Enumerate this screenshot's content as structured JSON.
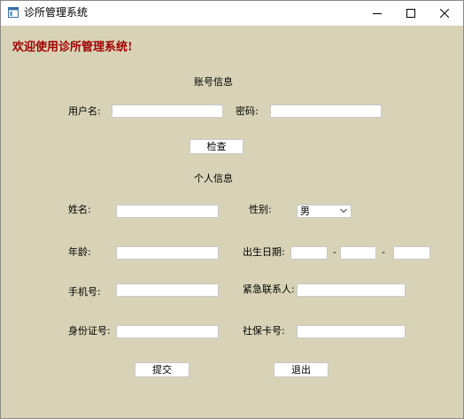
{
  "window": {
    "title": "诊所管理系统"
  },
  "welcome": "欢迎使用诊所管理系统!",
  "account": {
    "section_title": "账号信息",
    "username_label": "用户名:",
    "username_value": "",
    "password_label": "密码:",
    "password_value": "",
    "check_button": "检查"
  },
  "personal": {
    "section_title": "个人信息",
    "name_label": "姓名:",
    "name_value": "",
    "gender_label": "性别:",
    "gender_value": "男",
    "age_label": "年龄:",
    "age_value": "",
    "birth_label": "出生日期:",
    "birth_year": "",
    "birth_month": "",
    "birth_day": "",
    "date_separator": "-",
    "phone_label": "手机号:",
    "phone_value": "",
    "emergency_label": "紧急联系人:",
    "emergency_value": "",
    "id_label": "身份证号:",
    "id_value": "",
    "social_label": "社保卡号:",
    "social_value": ""
  },
  "actions": {
    "submit": "提交",
    "exit": "退出"
  }
}
